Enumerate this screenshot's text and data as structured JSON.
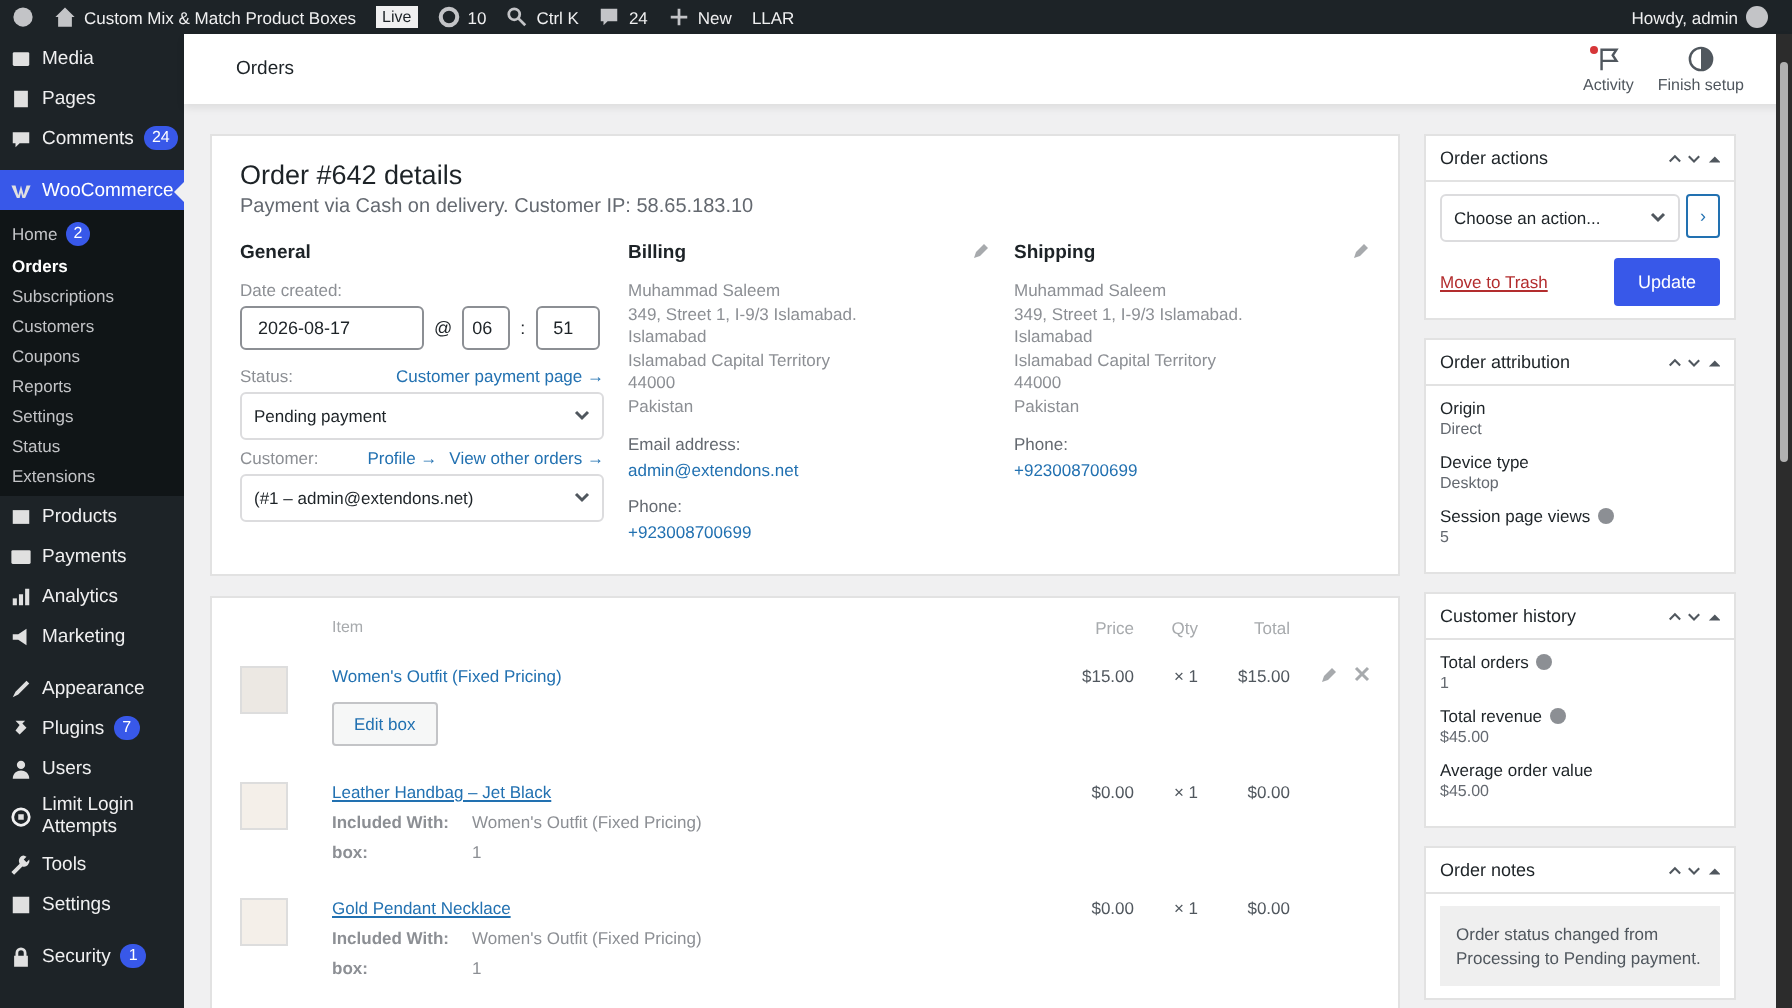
{
  "admin_bar": {
    "site_title": "Custom Mix & Match Product Boxes",
    "live_badge": "Live",
    "updates": "10",
    "search": "Ctrl K",
    "comments": "24",
    "new": "New",
    "plugin": "LLAR",
    "greeting": "Howdy, admin"
  },
  "sidebar": {
    "groups": [
      [
        {
          "label": "Media",
          "current": false
        },
        {
          "label": "Pages",
          "current": false
        },
        {
          "label": "Comments",
          "badge": "24",
          "current": false
        }
      ],
      [
        {
          "label": "WooCommerce",
          "current": true,
          "children": [
            {
              "label": "Home",
              "badge": "2",
              "selected": false
            },
            {
              "label": "Orders",
              "selected": true
            },
            {
              "label": "Subscriptions",
              "selected": false
            },
            {
              "label": "Customers",
              "selected": false
            },
            {
              "label": "Coupons",
              "selected": false
            },
            {
              "label": "Reports",
              "selected": false
            },
            {
              "label": "Settings",
              "selected": false
            },
            {
              "label": "Status",
              "selected": false
            },
            {
              "label": "Extensions",
              "selected": false
            }
          ]
        },
        {
          "label": "Products",
          "current": false
        },
        {
          "label": "Payments",
          "current": false
        },
        {
          "label": "Analytics",
          "current": false
        },
        {
          "label": "Marketing",
          "current": false
        }
      ],
      [
        {
          "label": "Appearance",
          "current": false
        },
        {
          "label": "Plugins",
          "badge": "7",
          "current": false
        },
        {
          "label": "Users",
          "current": false
        },
        {
          "label": "Limit Login Attempts",
          "current": false
        },
        {
          "label": "Tools",
          "current": false
        },
        {
          "label": "Settings",
          "current": false
        }
      ],
      [
        {
          "label": "Security",
          "badge": "1",
          "current": false
        }
      ]
    ]
  },
  "page_header": {
    "title": "Orders",
    "actions": [
      {
        "label": "Activity",
        "unread": true
      },
      {
        "label": "Finish setup",
        "unread": false
      }
    ]
  },
  "order": {
    "title": "Order #642 details",
    "subtitle": "Payment via Cash on delivery. Customer IP: 58.65.183.10",
    "general": {
      "heading": "General",
      "date_label": "Date created:",
      "date": "2026-08-17",
      "at": "@",
      "hour": "06",
      "colon": ":",
      "minute": "51",
      "status_label": "Status:",
      "status_link": "Customer payment page →",
      "status_value": "Pending payment",
      "customer_label": "Customer:",
      "customer_links": [
        "Profile →",
        "View other orders →"
      ],
      "customer_value": "(#1 – admin@extendons.net)"
    },
    "billing": {
      "heading": "Billing",
      "lines": [
        "Muhammad Saleem",
        "349, Street 1, I-9/3 Islamabad.",
        "Islamabad",
        "Islamabad Capital Territory",
        "44000",
        "Pakistan"
      ],
      "fields": [
        {
          "label": "Email address:",
          "value": "admin@extendons.net"
        },
        {
          "label": "Phone:",
          "value": "+923008700699"
        }
      ]
    },
    "shipping": {
      "heading": "Shipping",
      "lines": [
        "Muhammad Saleem",
        "349, Street 1, I-9/3 Islamabad.",
        "Islamabad",
        "Islamabad Capital Territory",
        "44000",
        "Pakistan"
      ],
      "fields": [
        {
          "label": "Phone:",
          "value": "+923008700699"
        }
      ]
    }
  },
  "items": {
    "columns": [
      "Item",
      "Price",
      "Qty",
      "Total"
    ],
    "rows": [
      {
        "kind": "bundle",
        "name": "Women's Outfit (Fixed Pricing)",
        "button": "Edit box",
        "price": "$15.00",
        "qty": "× 1",
        "total": "$15.00"
      },
      {
        "kind": "child",
        "name": "Leather Handbag – Jet Black",
        "meta": [
          {
            "key": "Included With:",
            "value": "Women's Outfit (Fixed Pricing)"
          },
          {
            "key": "box:",
            "value": "1"
          }
        ],
        "price": "$0.00",
        "qty": "× 1",
        "total": "$0.00"
      },
      {
        "kind": "child",
        "name": "Gold Pendant Necklace",
        "meta": [
          {
            "key": "Included With:",
            "value": "Women's Outfit (Fixed Pricing)"
          },
          {
            "key": "box:",
            "value": "1"
          }
        ],
        "price": "$0.00",
        "qty": "× 1",
        "total": "$0.00"
      }
    ]
  },
  "boxes": [
    {
      "kind": "actions",
      "title": "Order actions",
      "select": "Choose an action...",
      "go": "›",
      "trash": "Move to Trash",
      "button": "Update"
    },
    {
      "kind": "fields",
      "title": "Order attribution",
      "fields": [
        {
          "label": "Origin",
          "value": "Direct",
          "help": false
        },
        {
          "label": "Device type",
          "value": "Desktop",
          "help": false
        },
        {
          "label": "Session page views",
          "value": "5",
          "help": true
        }
      ]
    },
    {
      "kind": "fields",
      "title": "Customer history",
      "fields": [
        {
          "label": "Total orders",
          "value": "1",
          "help": true
        },
        {
          "label": "Total revenue",
          "value": "$45.00",
          "help": true
        },
        {
          "label": "Average order value",
          "value": "$45.00",
          "help": false
        }
      ]
    },
    {
      "kind": "notes",
      "title": "Order notes",
      "notes": [
        "Order status changed from Processing to Pending payment."
      ]
    }
  ]
}
